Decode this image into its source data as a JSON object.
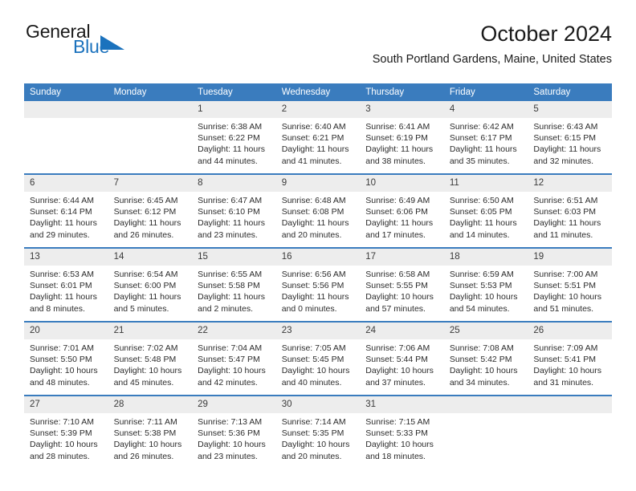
{
  "brand": {
    "name_part1": "General",
    "name_part2": "Blue",
    "logo_icon": "triangle-flag-icon",
    "accent_color": "#1b72bd"
  },
  "header": {
    "month_title": "October 2024",
    "location": "South Portland Gardens, Maine, United States"
  },
  "theme": {
    "header_row_color": "#3a7cbe",
    "daynum_strip_color": "#ededed",
    "text_color": "#2b2b2b"
  },
  "calendar": {
    "weekday_headers": [
      "Sunday",
      "Monday",
      "Tuesday",
      "Wednesday",
      "Thursday",
      "Friday",
      "Saturday"
    ],
    "weeks": [
      [
        {
          "day": "",
          "blank": true,
          "sunrise": "",
          "sunset": "",
          "daylight_line1": "",
          "daylight_line2": ""
        },
        {
          "day": "",
          "blank": true,
          "sunrise": "",
          "sunset": "",
          "daylight_line1": "",
          "daylight_line2": ""
        },
        {
          "day": "1",
          "sunrise": "Sunrise: 6:38 AM",
          "sunset": "Sunset: 6:22 PM",
          "daylight_line1": "Daylight: 11 hours",
          "daylight_line2": "and 44 minutes."
        },
        {
          "day": "2",
          "sunrise": "Sunrise: 6:40 AM",
          "sunset": "Sunset: 6:21 PM",
          "daylight_line1": "Daylight: 11 hours",
          "daylight_line2": "and 41 minutes."
        },
        {
          "day": "3",
          "sunrise": "Sunrise: 6:41 AM",
          "sunset": "Sunset: 6:19 PM",
          "daylight_line1": "Daylight: 11 hours",
          "daylight_line2": "and 38 minutes."
        },
        {
          "day": "4",
          "sunrise": "Sunrise: 6:42 AM",
          "sunset": "Sunset: 6:17 PM",
          "daylight_line1": "Daylight: 11 hours",
          "daylight_line2": "and 35 minutes."
        },
        {
          "day": "5",
          "sunrise": "Sunrise: 6:43 AM",
          "sunset": "Sunset: 6:15 PM",
          "daylight_line1": "Daylight: 11 hours",
          "daylight_line2": "and 32 minutes."
        }
      ],
      [
        {
          "day": "6",
          "sunrise": "Sunrise: 6:44 AM",
          "sunset": "Sunset: 6:14 PM",
          "daylight_line1": "Daylight: 11 hours",
          "daylight_line2": "and 29 minutes."
        },
        {
          "day": "7",
          "sunrise": "Sunrise: 6:45 AM",
          "sunset": "Sunset: 6:12 PM",
          "daylight_line1": "Daylight: 11 hours",
          "daylight_line2": "and 26 minutes."
        },
        {
          "day": "8",
          "sunrise": "Sunrise: 6:47 AM",
          "sunset": "Sunset: 6:10 PM",
          "daylight_line1": "Daylight: 11 hours",
          "daylight_line2": "and 23 minutes."
        },
        {
          "day": "9",
          "sunrise": "Sunrise: 6:48 AM",
          "sunset": "Sunset: 6:08 PM",
          "daylight_line1": "Daylight: 11 hours",
          "daylight_line2": "and 20 minutes."
        },
        {
          "day": "10",
          "sunrise": "Sunrise: 6:49 AM",
          "sunset": "Sunset: 6:06 PM",
          "daylight_line1": "Daylight: 11 hours",
          "daylight_line2": "and 17 minutes."
        },
        {
          "day": "11",
          "sunrise": "Sunrise: 6:50 AM",
          "sunset": "Sunset: 6:05 PM",
          "daylight_line1": "Daylight: 11 hours",
          "daylight_line2": "and 14 minutes."
        },
        {
          "day": "12",
          "sunrise": "Sunrise: 6:51 AM",
          "sunset": "Sunset: 6:03 PM",
          "daylight_line1": "Daylight: 11 hours",
          "daylight_line2": "and 11 minutes."
        }
      ],
      [
        {
          "day": "13",
          "sunrise": "Sunrise: 6:53 AM",
          "sunset": "Sunset: 6:01 PM",
          "daylight_line1": "Daylight: 11 hours",
          "daylight_line2": "and 8 minutes."
        },
        {
          "day": "14",
          "sunrise": "Sunrise: 6:54 AM",
          "sunset": "Sunset: 6:00 PM",
          "daylight_line1": "Daylight: 11 hours",
          "daylight_line2": "and 5 minutes."
        },
        {
          "day": "15",
          "sunrise": "Sunrise: 6:55 AM",
          "sunset": "Sunset: 5:58 PM",
          "daylight_line1": "Daylight: 11 hours",
          "daylight_line2": "and 2 minutes."
        },
        {
          "day": "16",
          "sunrise": "Sunrise: 6:56 AM",
          "sunset": "Sunset: 5:56 PM",
          "daylight_line1": "Daylight: 11 hours",
          "daylight_line2": "and 0 minutes."
        },
        {
          "day": "17",
          "sunrise": "Sunrise: 6:58 AM",
          "sunset": "Sunset: 5:55 PM",
          "daylight_line1": "Daylight: 10 hours",
          "daylight_line2": "and 57 minutes."
        },
        {
          "day": "18",
          "sunrise": "Sunrise: 6:59 AM",
          "sunset": "Sunset: 5:53 PM",
          "daylight_line1": "Daylight: 10 hours",
          "daylight_line2": "and 54 minutes."
        },
        {
          "day": "19",
          "sunrise": "Sunrise: 7:00 AM",
          "sunset": "Sunset: 5:51 PM",
          "daylight_line1": "Daylight: 10 hours",
          "daylight_line2": "and 51 minutes."
        }
      ],
      [
        {
          "day": "20",
          "sunrise": "Sunrise: 7:01 AM",
          "sunset": "Sunset: 5:50 PM",
          "daylight_line1": "Daylight: 10 hours",
          "daylight_line2": "and 48 minutes."
        },
        {
          "day": "21",
          "sunrise": "Sunrise: 7:02 AM",
          "sunset": "Sunset: 5:48 PM",
          "daylight_line1": "Daylight: 10 hours",
          "daylight_line2": "and 45 minutes."
        },
        {
          "day": "22",
          "sunrise": "Sunrise: 7:04 AM",
          "sunset": "Sunset: 5:47 PM",
          "daylight_line1": "Daylight: 10 hours",
          "daylight_line2": "and 42 minutes."
        },
        {
          "day": "23",
          "sunrise": "Sunrise: 7:05 AM",
          "sunset": "Sunset: 5:45 PM",
          "daylight_line1": "Daylight: 10 hours",
          "daylight_line2": "and 40 minutes."
        },
        {
          "day": "24",
          "sunrise": "Sunrise: 7:06 AM",
          "sunset": "Sunset: 5:44 PM",
          "daylight_line1": "Daylight: 10 hours",
          "daylight_line2": "and 37 minutes."
        },
        {
          "day": "25",
          "sunrise": "Sunrise: 7:08 AM",
          "sunset": "Sunset: 5:42 PM",
          "daylight_line1": "Daylight: 10 hours",
          "daylight_line2": "and 34 minutes."
        },
        {
          "day": "26",
          "sunrise": "Sunrise: 7:09 AM",
          "sunset": "Sunset: 5:41 PM",
          "daylight_line1": "Daylight: 10 hours",
          "daylight_line2": "and 31 minutes."
        }
      ],
      [
        {
          "day": "27",
          "sunrise": "Sunrise: 7:10 AM",
          "sunset": "Sunset: 5:39 PM",
          "daylight_line1": "Daylight: 10 hours",
          "daylight_line2": "and 28 minutes."
        },
        {
          "day": "28",
          "sunrise": "Sunrise: 7:11 AM",
          "sunset": "Sunset: 5:38 PM",
          "daylight_line1": "Daylight: 10 hours",
          "daylight_line2": "and 26 minutes."
        },
        {
          "day": "29",
          "sunrise": "Sunrise: 7:13 AM",
          "sunset": "Sunset: 5:36 PM",
          "daylight_line1": "Daylight: 10 hours",
          "daylight_line2": "and 23 minutes."
        },
        {
          "day": "30",
          "sunrise": "Sunrise: 7:14 AM",
          "sunset": "Sunset: 5:35 PM",
          "daylight_line1": "Daylight: 10 hours",
          "daylight_line2": "and 20 minutes."
        },
        {
          "day": "31",
          "sunrise": "Sunrise: 7:15 AM",
          "sunset": "Sunset: 5:33 PM",
          "daylight_line1": "Daylight: 10 hours",
          "daylight_line2": "and 18 minutes."
        },
        {
          "day": "",
          "blank": true,
          "sunrise": "",
          "sunset": "",
          "daylight_line1": "",
          "daylight_line2": ""
        },
        {
          "day": "",
          "blank": true,
          "sunrise": "",
          "sunset": "",
          "daylight_line1": "",
          "daylight_line2": ""
        }
      ]
    ]
  }
}
